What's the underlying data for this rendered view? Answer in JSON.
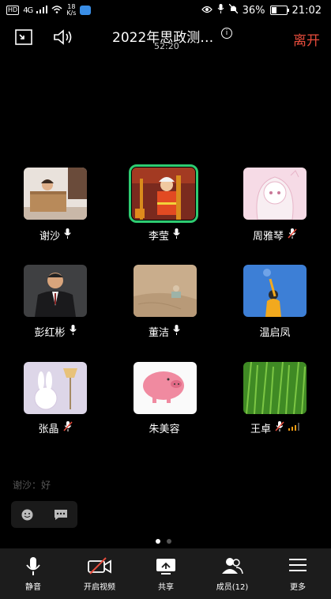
{
  "status_bar": {
    "hd": "HD",
    "network": "4G",
    "speed_value": "18",
    "speed_unit": "K/s",
    "battery": "36%",
    "time": "21:02",
    "battery_level": 0.36
  },
  "meeting": {
    "title": "2022年思政测…",
    "duration": "52:20",
    "leave_label": "离开",
    "info_glyph": "i"
  },
  "participants": [
    {
      "name": "谢沙",
      "mic": "on",
      "active": false,
      "avatar": "child-in-box"
    },
    {
      "name": "李莹",
      "mic": "on",
      "active": true,
      "avatar": "firefighter-child"
    },
    {
      "name": "周雅琴",
      "mic": "muted",
      "active": false,
      "avatar": "anime-girl"
    },
    {
      "name": "彭红彬",
      "mic": "on",
      "active": false,
      "avatar": "man-in-suit"
    },
    {
      "name": "董洁",
      "mic": "on",
      "active": false,
      "avatar": "toy-on-sand"
    },
    {
      "name": "温启凤",
      "mic": "none",
      "active": false,
      "avatar": "girl-blue-sky"
    },
    {
      "name": "张晶",
      "mic": "muted",
      "active": false,
      "avatar": "bunny-lamp"
    },
    {
      "name": "朱美容",
      "mic": "none",
      "active": false,
      "avatar": "pink-pig"
    },
    {
      "name": "王卓",
      "mic": "muted",
      "active": false,
      "avatar": "green-grass",
      "signal": "weak"
    }
  ],
  "chat": {
    "last_message": "谢沙：好"
  },
  "pager": {
    "pages": 2,
    "current": 1
  },
  "toolbar": {
    "mute_label": "静音",
    "video_label": "开启视频",
    "share_label": "共享",
    "members_label": "成员(12)",
    "more_label": "更多"
  },
  "colors": {
    "accent_green": "#2ecc71",
    "leave_red": "#e74c3c",
    "muted_red": "#e74c3c",
    "signal_orange": "#f39c12"
  }
}
